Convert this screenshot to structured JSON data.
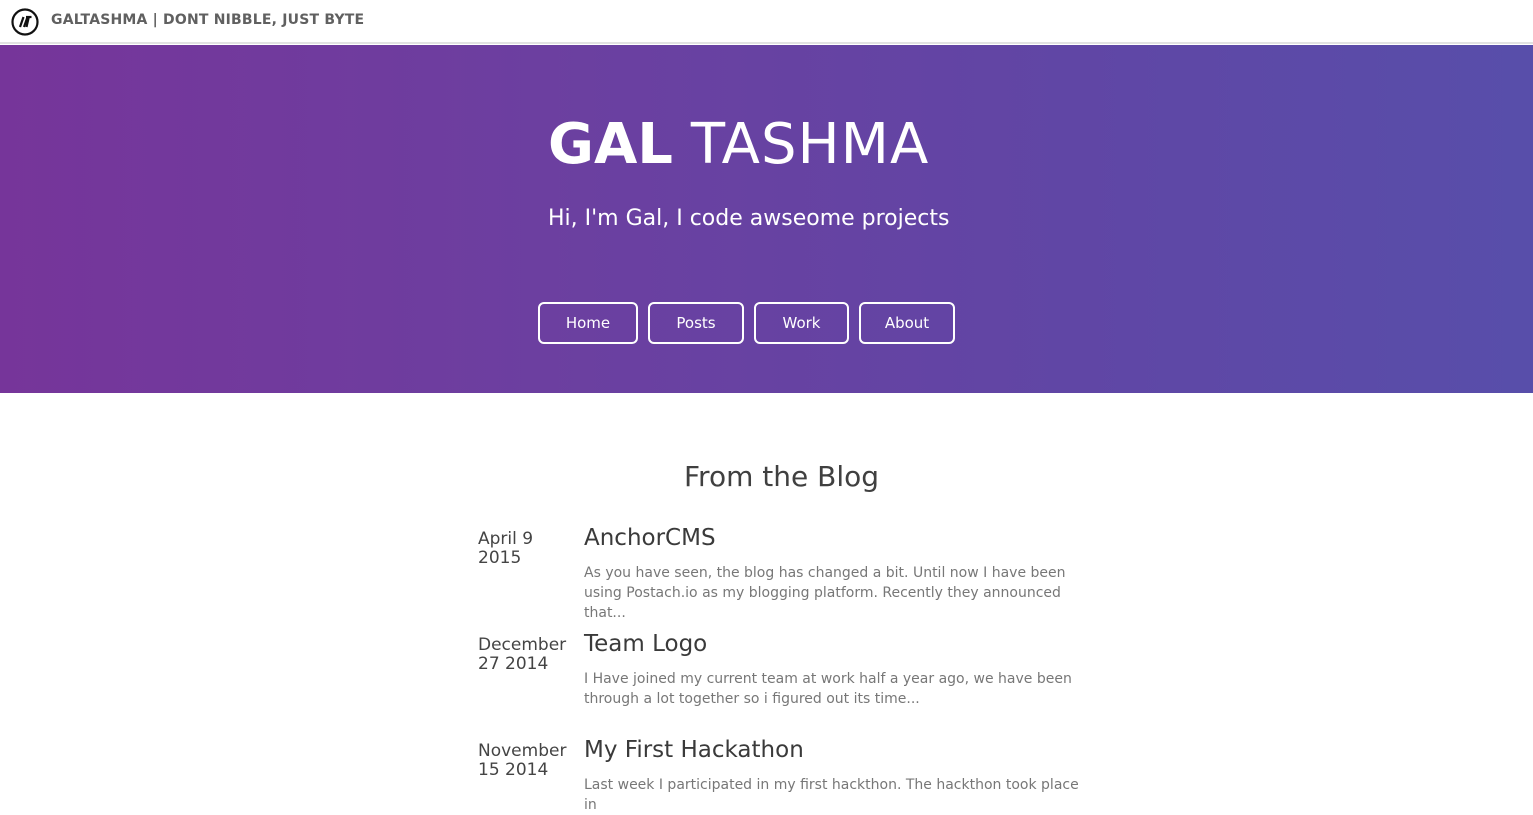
{
  "header": {
    "site_title": "GALTASHMA | DONT NIBBLE, JUST BYTE",
    "logo_icon": "gt-logo-icon"
  },
  "hero": {
    "title_first": "GAL",
    "title_last": "TASHMA",
    "subtitle": "Hi, I'm Gal, I code awseome projects",
    "background_start": "#76359a",
    "background_end": "#584eaa"
  },
  "nav": {
    "items": [
      {
        "label": "Home"
      },
      {
        "label": "Posts"
      },
      {
        "label": "Work"
      },
      {
        "label": "About"
      }
    ]
  },
  "blog": {
    "heading": "From the Blog",
    "posts": [
      {
        "date_line1": "April 9",
        "date_line2": "2015",
        "title": "AnchorCMS",
        "excerpt": "As you have seen, the blog has changed a bit. Until now I have been using Postach.io as my blogging platform. Recently they announced that..."
      },
      {
        "date_line1": "December",
        "date_line2": "27 2014",
        "title": "Team Logo",
        "excerpt": "I Have joined my current team at work half a year ago, we have been through a lot together so i figured out its time..."
      },
      {
        "date_line1": "November",
        "date_line2": "15 2014",
        "title": "My First Hackathon",
        "excerpt": "Last week I participated in my first hackthon. The hackthon took place in"
      }
    ]
  }
}
